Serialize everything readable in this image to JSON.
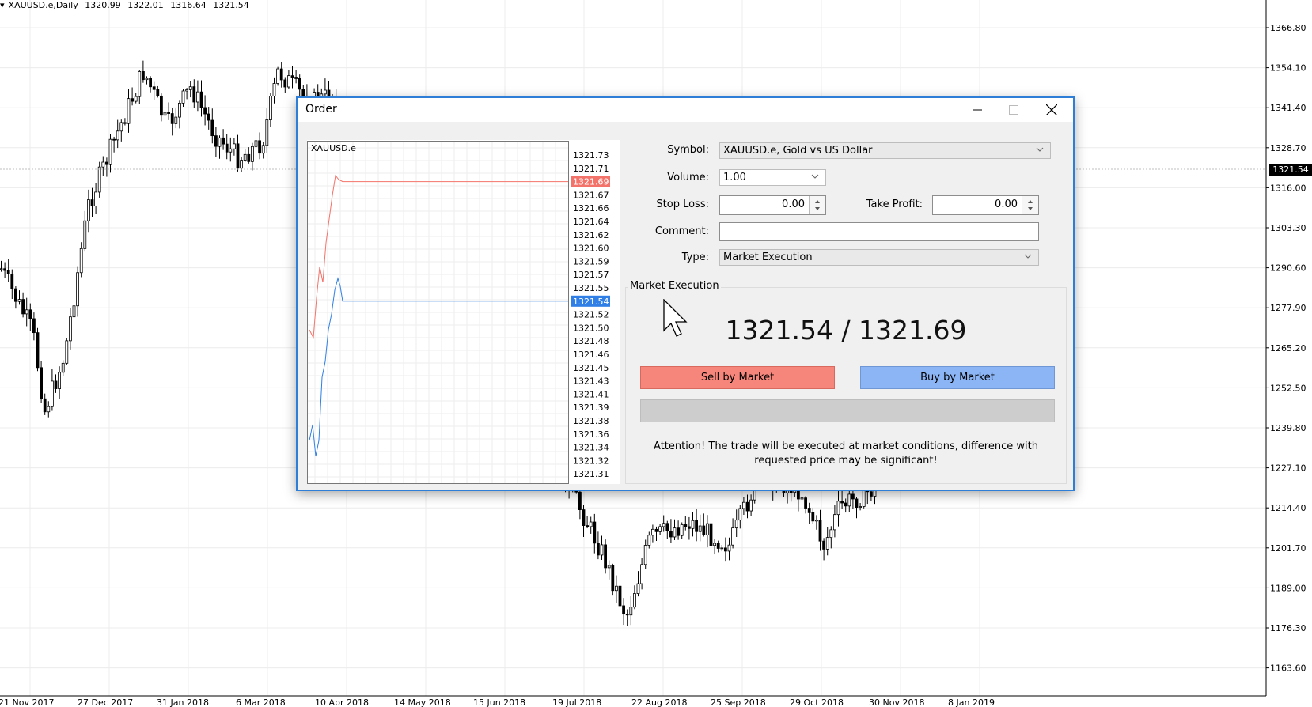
{
  "chart": {
    "symbol_timeframe": "XAUUSD.e,Daily",
    "ohlc": [
      "1320.99",
      "1322.01",
      "1316.64",
      "1321.54"
    ],
    "price_labels": [
      "1366.80",
      "1354.10",
      "1341.40",
      "1328.70",
      "1316.00",
      "1303.30",
      "1290.60",
      "1277.90",
      "1265.20",
      "1252.50",
      "1239.80",
      "1227.10",
      "1214.40",
      "1201.70",
      "1189.00",
      "1176.30",
      "1163.60"
    ],
    "current_price": "1321.54",
    "current_price_color": "#000000",
    "date_labels": [
      "21 Nov 2017",
      "27 Dec 2017",
      "31 Jan 2018",
      "6 Mar 2018",
      "10 Apr 2018",
      "14 May 2018",
      "15 Jun 2018",
      "19 Jul 2018",
      "22 Aug 2018",
      "25 Sep 2018",
      "29 Oct 2018",
      "30 Nov 2018",
      "8 Jan 2019"
    ]
  },
  "dialog": {
    "title": "Order",
    "window_buttons": [
      "minimize-icon",
      "maximize-icon",
      "close-icon"
    ],
    "tick_chart": {
      "symbol": "XAUUSD.e",
      "prices": [
        "1321.73",
        "1321.71",
        "1321.69",
        "1321.67",
        "1321.66",
        "1321.64",
        "1321.62",
        "1321.60",
        "1321.59",
        "1321.57",
        "1321.55",
        "1321.54",
        "1321.52",
        "1321.50",
        "1321.48",
        "1321.46",
        "1321.45",
        "1321.43",
        "1321.41",
        "1321.39",
        "1321.38",
        "1321.36",
        "1321.34",
        "1321.32",
        "1321.31"
      ],
      "ask": "1321.69",
      "bid": "1321.54",
      "ask_color": "#f3736a",
      "bid_color": "#2f7fe6"
    },
    "form": {
      "symbol_label": "Symbol:",
      "symbol_value": "XAUUSD.e, Gold vs US Dollar",
      "volume_label": "Volume:",
      "volume_value": "1.00",
      "stop_loss_label": "Stop Loss:",
      "stop_loss_value": "0.00",
      "take_profit_label": "Take Profit:",
      "take_profit_value": "0.00",
      "comment_label": "Comment:",
      "comment_value": "",
      "type_label": "Type:",
      "type_value": "Market Execution"
    },
    "execution": {
      "group_title": "Market Execution",
      "price_text": "1321.54 / 1321.69",
      "sell_label": "Sell by Market",
      "buy_label": "Buy by Market",
      "sell_color": "#f6867b",
      "buy_color": "#8cb5f6",
      "attention_line1": "Attention! The trade will be executed at market conditions, difference with",
      "attention_line2": "requested price may be significant!"
    }
  }
}
